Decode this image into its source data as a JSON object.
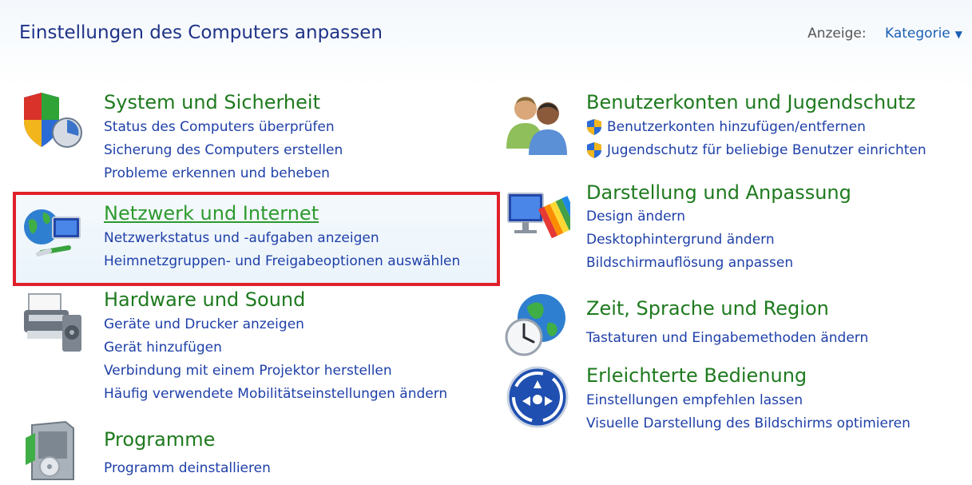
{
  "header": {
    "title": "Einstellungen des Computers anpassen",
    "view_label": "Anzeige:",
    "view_value": "Kategorie"
  },
  "categories": {
    "system": {
      "title": "System und Sicherheit",
      "links": [
        "Status des Computers überprüfen",
        "Sicherung des Computers erstellen",
        "Probleme erkennen und beheben"
      ]
    },
    "network": {
      "title": "Netzwerk und Internet",
      "links": [
        "Netzwerkstatus und -aufgaben anzeigen",
        "Heimnetzgruppen- und Freigabeoptionen auswählen"
      ]
    },
    "hardware": {
      "title": "Hardware und Sound",
      "links": [
        "Geräte und Drucker anzeigen",
        "Gerät hinzufügen",
        "Verbindung mit einem Projektor herstellen",
        "Häufig verwendete Mobilitätseinstellungen ändern"
      ]
    },
    "programs": {
      "title": "Programme",
      "links": [
        "Programm deinstallieren"
      ]
    },
    "users": {
      "title": "Benutzerkonten und Jugendschutz",
      "links": [
        "Benutzerkonten hinzufügen/entfernen",
        "Jugendschutz für beliebige Benutzer einrichten"
      ]
    },
    "appearance": {
      "title": "Darstellung und Anpassung",
      "links": [
        "Design ändern",
        "Desktophintergrund ändern",
        "Bildschirmauflösung anpassen"
      ]
    },
    "clock": {
      "title": "Zeit, Sprache und Region",
      "links": [
        "Tastaturen und Eingabemethoden ändern"
      ]
    },
    "ease": {
      "title": "Erleichterte Bedienung",
      "links": [
        "Einstellungen empfehlen lassen",
        "Visuelle Darstellung des Bildschirms optimieren"
      ]
    }
  },
  "colors": {
    "category_title": "#1e7a1e",
    "link": "#1e3fa8",
    "highlight_border": "#e0202a"
  }
}
